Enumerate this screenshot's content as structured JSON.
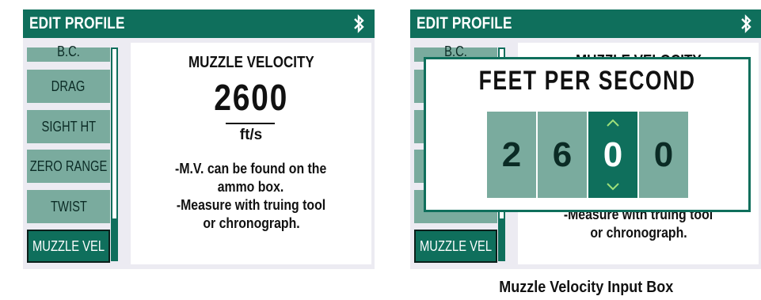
{
  "left": {
    "title": "EDIT PROFILE",
    "menu": [
      "B.C.",
      "DRAG",
      "SIGHT HT",
      "ZERO RANGE",
      "TWIST",
      "MUZZLE VEL"
    ],
    "info": {
      "heading": "MUZZLE VELOCITY",
      "value": "2600",
      "unit": "ft/s",
      "note_lines": [
        "-M.V. can be found on the",
        "ammo box.",
        "-Measure with truing tool",
        "or chronograph."
      ]
    }
  },
  "right": {
    "title": "EDIT PROFILE",
    "menu_visible": [
      "B.C.",
      "MUZZLE VEL"
    ],
    "info_visible": {
      "heading_partial": "MUZZLE VELOCITY",
      "note_partial": "-Measure with truing tool",
      "note_last": "or chronograph."
    },
    "popup": {
      "title": "FEET PER SECOND",
      "digits": [
        "2",
        "6",
        "0",
        "0"
      ],
      "active_index": 2
    }
  },
  "caption": "Muzzle Velocity Input Box",
  "colors": {
    "accent": "#0f6f5c",
    "menu_bg": "#7aab9e",
    "screen_bg": "#ecebf2"
  },
  "icons": {
    "status": "bluetooth-icon",
    "up": "chevron-up-icon",
    "down": "chevron-down-icon"
  }
}
